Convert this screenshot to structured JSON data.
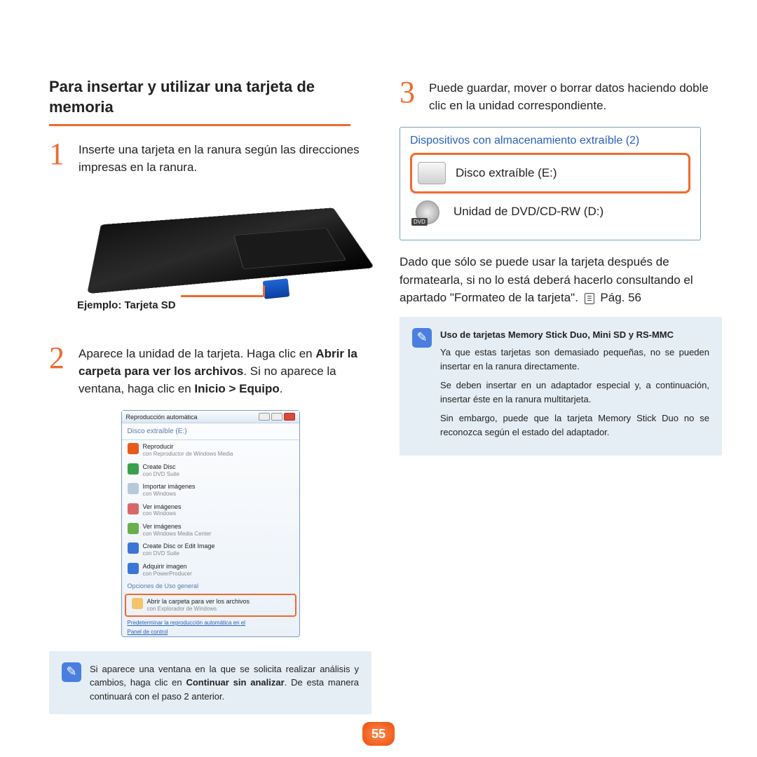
{
  "title": "Para insertar y utilizar una tarjeta de memoria",
  "step1": {
    "num": "1",
    "text": "Inserte una tarjeta en la ranura según las direcciones impresas en la ranura."
  },
  "callout": "Ejemplo: Tarjeta SD",
  "step2": {
    "num": "2",
    "pre": "Aparece la unidad de la tarjeta. Haga clic en ",
    "b1": "Abrir la carpeta para ver los archivos",
    "mid": ". Si no aparece la ventana, haga clic en ",
    "b2": "Inicio > Equipo",
    "post": "."
  },
  "autoplay": {
    "title": "Reproducción automática",
    "sub": "Disco extraíble (E:)",
    "items": [
      {
        "main": "Reproducir",
        "below": "con Reproductor de Windows Media",
        "color": "#e85a1a"
      },
      {
        "main": "Create Disc",
        "below": "con DVD Suite",
        "color": "#3aa04a"
      },
      {
        "main": "Importar imágenes",
        "below": "con Windows",
        "color": "#b8c8d8"
      },
      {
        "main": "Ver imágenes",
        "below": "con Windows",
        "color": "#d86868"
      },
      {
        "main": "Ver imágenes",
        "below": "con Windows Media Center",
        "color": "#6ab04a"
      },
      {
        "main": "Create Disc or Edit Image",
        "below": "con DVD Suite",
        "color": "#3a75d8"
      },
      {
        "main": "Adquirir imagen",
        "below": "con PowerProducer",
        "color": "#3a75d8"
      }
    ],
    "group": "Opciones de Uso general",
    "highlight": {
      "main": "Abrir la carpeta para ver los archivos",
      "below": "con Explorador de Windows"
    },
    "link1": "Predeterminar la reproducción automática en el",
    "link2": "Panel de control"
  },
  "note1": {
    "pre": "Si aparece una ventana en la que se solicita realizar análisis y cambios, haga clic en ",
    "b": "Continuar sin analizar",
    "post": ". De esta manera continuará con el paso 2 anterior."
  },
  "step3": {
    "num": "3",
    "text": "Puede guardar, mover o borrar datos haciendo doble clic en la unidad correspondiente."
  },
  "devices": {
    "title": "Dispositivos con almacenamiento extraíble (2)",
    "row1": "Disco extraíble (E:)",
    "row2": "Unidad de DVD/CD-RW (D:)",
    "dvd_badge": "DVD"
  },
  "para2": "Dado que sólo se puede usar la tarjeta después de formatearla, si no lo está deberá hacerlo consultando el apartado \"Formateo de la tarjeta\".",
  "pg_ref": "Pág. 56",
  "note2": {
    "title": "Uso de tarjetas Memory Stick Duo, Mini SD y RS-MMC",
    "p1": "Ya que estas tarjetas son demasiado pequeñas, no se pueden insertar en la ranura directamente.",
    "p2": "Se deben insertar en un adaptador especial y, a continuación, insertar éste en la ranura multitarjeta.",
    "p3": "Sin embargo, puede que la tarjeta Memory Stick Duo no se reconozca según el estado del adaptador."
  },
  "page_num": "55"
}
